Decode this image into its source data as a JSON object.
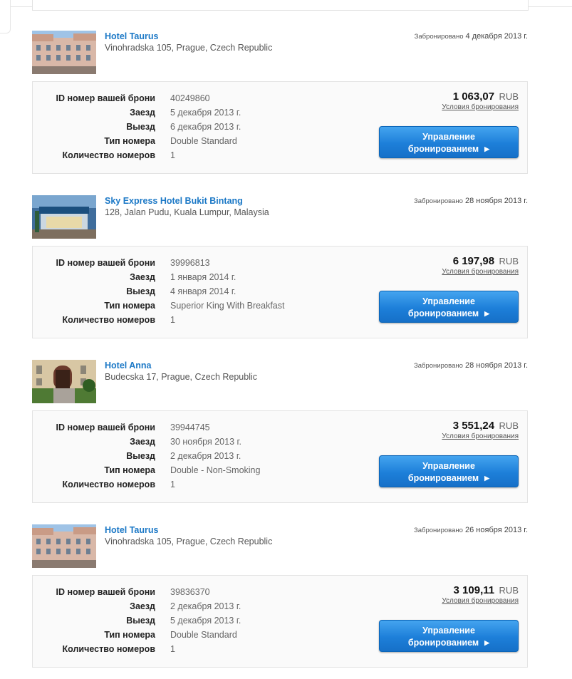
{
  "bookings": [
    {
      "hotel_name": "Hotel Taurus",
      "address": "Vinohradska 105, Prague, Czech Republic",
      "booked_label": "Забронировано",
      "booked_date": "4 декабря 2013 г.",
      "id_label": "ID номер вашей брони",
      "id_value": "40249860",
      "checkin_label": "Заезд",
      "checkin_value": "5 декабря 2013 г.",
      "checkout_label": "Выезд",
      "checkout_value": "6 декабря 2013 г.",
      "room_label": "Тип номера",
      "room_value": "Double Standard",
      "count_label": "Количество номеров",
      "count_value": "1",
      "price": "1 063,07",
      "currency": "RUB",
      "terms_label": "Условия бронирования",
      "manage_line1": "Управление",
      "manage_line2": "бронированием",
      "thumb_icon": "hotel-photo-icon"
    },
    {
      "hotel_name": "Sky Express Hotel Bukit Bintang",
      "address": "128, Jalan Pudu, Kuala Lumpur, Malaysia",
      "booked_label": "Забронировано",
      "booked_date": "28 ноября 2013 г.",
      "id_label": "ID номер вашей брони",
      "id_value": "39996813",
      "checkin_label": "Заезд",
      "checkin_value": "1 января 2014 г.",
      "checkout_label": "Выезд",
      "checkout_value": "4 января 2014 г.",
      "room_label": "Тип номера",
      "room_value": "Superior King With Breakfast",
      "count_label": "Количество номеров",
      "count_value": "1",
      "price": "6 197,98",
      "currency": "RUB",
      "terms_label": "Условия бронирования",
      "manage_line1": "Управление",
      "manage_line2": "бронированием",
      "thumb_icon": "hotel-photo-icon"
    },
    {
      "hotel_name": "Hotel Anna",
      "address": "Budecska 17, Prague, Czech Republic",
      "booked_label": "Забронировано",
      "booked_date": "28 ноября 2013 г.",
      "id_label": "ID номер вашей брони",
      "id_value": "39944745",
      "checkin_label": "Заезд",
      "checkin_value": "30 ноября 2013 г.",
      "checkout_label": "Выезд",
      "checkout_value": "2 декабря 2013 г.",
      "room_label": "Тип номера",
      "room_value": "Double - Non-Smoking",
      "count_label": "Количество номеров",
      "count_value": "1",
      "price": "3 551,24",
      "currency": "RUB",
      "terms_label": "Условия бронирования",
      "manage_line1": "Управление",
      "manage_line2": "бронированием",
      "thumb_icon": "hotel-photo-icon"
    },
    {
      "hotel_name": "Hotel Taurus",
      "address": "Vinohradska 105, Prague, Czech Republic",
      "booked_label": "Забронировано",
      "booked_date": "26 ноября 2013 г.",
      "id_label": "ID номер вашей брони",
      "id_value": "39836370",
      "checkin_label": "Заезд",
      "checkin_value": "2 декабря 2013 г.",
      "checkout_label": "Выезд",
      "checkout_value": "5 декабря 2013 г.",
      "room_label": "Тип номера",
      "room_value": "Double Standard",
      "count_label": "Количество номеров",
      "count_value": "1",
      "price": "3 109,11",
      "currency": "RUB",
      "terms_label": "Условия бронирования",
      "manage_line1": "Управление",
      "manage_line2": "бронированием",
      "thumb_icon": "hotel-photo-icon"
    }
  ],
  "colors": {
    "link": "#1b78c6",
    "button": "#1d7fd9"
  }
}
